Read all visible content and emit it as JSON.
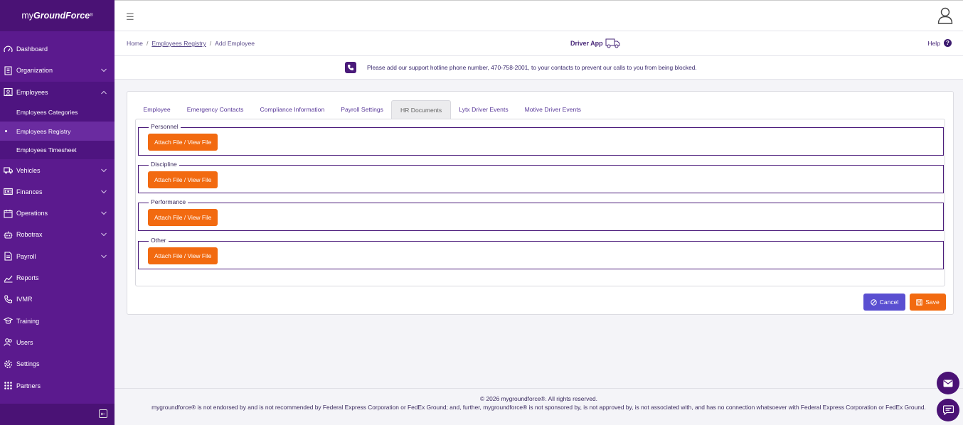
{
  "brand": {
    "prefix": "my",
    "bold": "GroundForce",
    "mark": "®"
  },
  "sidebar": {
    "items": [
      {
        "label": "Dashboard",
        "icon": "dashboard-icon",
        "chevron": false
      },
      {
        "label": "Organization",
        "icon": "building-icon",
        "chevron": true
      },
      {
        "label": "Employees",
        "icon": "employees-icon",
        "chevron": true,
        "open": true
      },
      {
        "label": "Vehicles",
        "icon": "truck-icon",
        "chevron": true
      },
      {
        "label": "Finances",
        "icon": "money-icon",
        "chevron": true
      },
      {
        "label": "Operations",
        "icon": "calendar-icon",
        "chevron": true
      },
      {
        "label": "Robotrax",
        "icon": "robot-icon",
        "chevron": true
      },
      {
        "label": "Payroll",
        "icon": "payroll-icon",
        "chevron": true
      },
      {
        "label": "Reports",
        "icon": "chart-line-icon",
        "chevron": false
      },
      {
        "label": "IVMR",
        "icon": "phone-icon",
        "chevron": false
      },
      {
        "label": "Training",
        "icon": "training-icon",
        "chevron": false
      },
      {
        "label": "Users",
        "icon": "users-icon",
        "chevron": false
      },
      {
        "label": "Settings",
        "icon": "gear-icon",
        "chevron": false
      },
      {
        "label": "Partners",
        "icon": "grid-icon",
        "chevron": false
      }
    ],
    "sub_items": [
      "Employees Categories",
      "Employees Registry",
      "Employees Timesheet"
    ]
  },
  "breadcrumb": {
    "home": "Home",
    "registry": "Employees Registry",
    "current": "Add Employee",
    "sep": "/"
  },
  "driver_app": "Driver App",
  "help": "Help",
  "notice": "Please add our support hotline phone number, 470-758-2001, to your contacts to prevent our calls to you from being blocked.",
  "tabs": [
    "Employee",
    "Emergency Contacts",
    "Compliance Information",
    "Payroll Settings",
    "HR Documents",
    "Lytx Driver Events",
    "Motive Driver Events"
  ],
  "active_tab": "HR Documents",
  "sections": [
    {
      "legend": "Personnel",
      "button": "Attach File / View File"
    },
    {
      "legend": "Discipline",
      "button": "Attach File / View File"
    },
    {
      "legend": "Performance",
      "button": "Attach File / View File"
    },
    {
      "legend": "Other",
      "button": "Attach File / View File"
    }
  ],
  "actions": {
    "cancel": "Cancel",
    "save": "Save"
  },
  "footer": {
    "line1": "© 2026 mygroundforce®. All rights reserved.",
    "line2": "mygroundforce® is not endorsed by and is not recommended by Federal Express Corporation or FedEx Ground; and, further, mygroundforce® is not sponsored by, is not approved by, is not associated with, and has no connection whatsoever with Federal Express Corporation or FedEx Ground."
  },
  "colors": {
    "sidebar": "#5b1a8e",
    "accent_orange": "#f26a10",
    "cancel_blue": "#5a4fd1"
  }
}
